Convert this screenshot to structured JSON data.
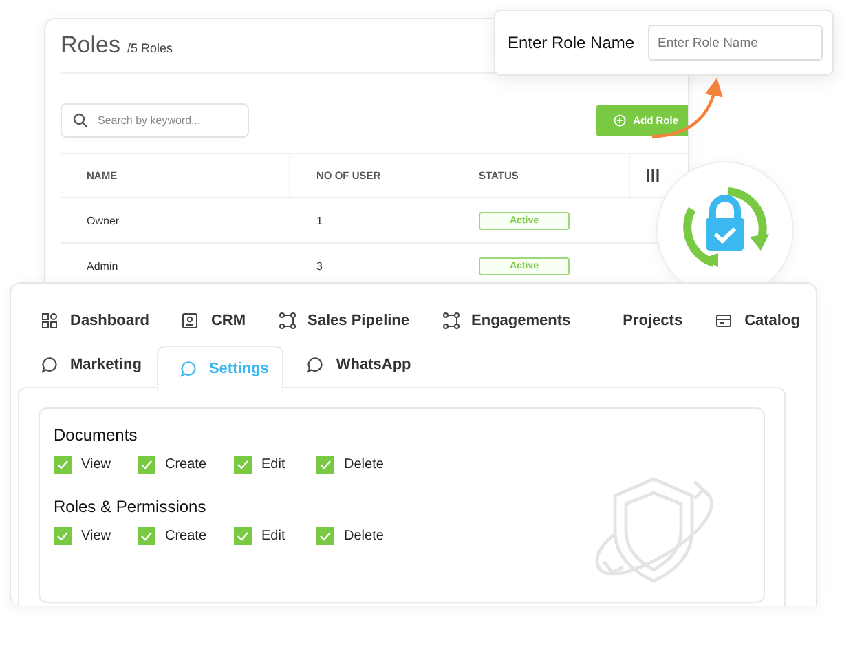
{
  "roles_panel": {
    "title": "Roles",
    "count": "/5 Roles",
    "search": {
      "placeholder": "Search by keyword..."
    },
    "add_button": "Add Role",
    "table": {
      "columns": [
        "NAME",
        "NO OF USER",
        "STATUS"
      ],
      "rows": [
        {
          "name": "Owner",
          "users": "1",
          "status": "Active"
        },
        {
          "name": "Admin",
          "users": "3",
          "status": "Active"
        }
      ]
    }
  },
  "role_name_popup": {
    "label": "Enter Role Name",
    "placeholder": "Enter Role Name"
  },
  "tab_rows": [
    [
      {
        "label": "Dashboard",
        "selected": false
      },
      {
        "label": "CRM",
        "selected": false
      },
      {
        "label": "Sales Pipeline",
        "selected": false
      },
      {
        "label": "Engagements",
        "selected": false
      },
      {
        "label": "Projects",
        "selected": false
      },
      {
        "label": "Catalog",
        "selected": false
      }
    ],
    [
      {
        "label": "Marketing",
        "selected": false
      },
      {
        "label": "Settings",
        "selected": true
      },
      {
        "label": "WhatsApp",
        "selected": false
      }
    ]
  ],
  "permissions": [
    {
      "heading": "Documents",
      "options": [
        {
          "label": "View",
          "checked": true
        },
        {
          "label": "Create",
          "checked": true
        },
        {
          "label": "Edit",
          "checked": true
        },
        {
          "label": "Delete",
          "checked": true
        }
      ]
    },
    {
      "heading": "Roles & Permissions",
      "options": [
        {
          "label": "View",
          "checked": true
        },
        {
          "label": "Create",
          "checked": true
        },
        {
          "label": "Edit",
          "checked": true
        },
        {
          "label": "Delete",
          "checked": true
        }
      ]
    }
  ]
}
